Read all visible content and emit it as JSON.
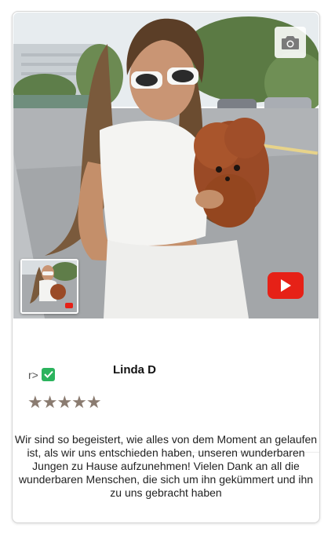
{
  "review": {
    "prefix_text": "r>",
    "reviewer_name": "Linda D",
    "stars": "★★★★★",
    "rating": 5,
    "text": "Wir sind so begeistert, wie alles von dem Moment an gelaufen ist, als wir uns entschieden haben, unseren wunderbaren Jungen zu Hause aufzunehmen! Vielen Dank an all die wunderbaren Menschen, die sich um ihn gekümmert und ihn zu uns gebracht haben"
  },
  "icons": {
    "camera": "camera-icon",
    "play": "play-icon",
    "verified": "check-icon"
  },
  "colors": {
    "play_button": "#e62117",
    "verified_badge": "#2bb35d",
    "star": "#8a7b70"
  }
}
